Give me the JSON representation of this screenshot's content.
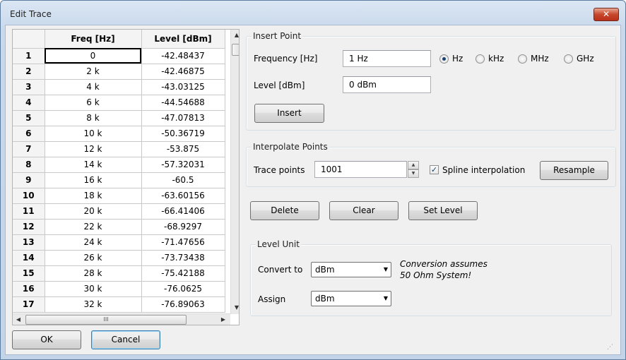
{
  "window": {
    "title": "Edit Trace",
    "close_label": "✕"
  },
  "table": {
    "headers": [
      "",
      "Freq [Hz]",
      "Level [dBm]"
    ],
    "rows": [
      {
        "n": "1",
        "freq": "0",
        "level": "-42.48437"
      },
      {
        "n": "2",
        "freq": "2 k",
        "level": "-42.46875"
      },
      {
        "n": "3",
        "freq": "4 k",
        "level": "-43.03125"
      },
      {
        "n": "4",
        "freq": "6 k",
        "level": "-44.54688"
      },
      {
        "n": "5",
        "freq": "8 k",
        "level": "-47.07813"
      },
      {
        "n": "6",
        "freq": "10 k",
        "level": "-50.36719"
      },
      {
        "n": "7",
        "freq": "12 k",
        "level": "-53.875"
      },
      {
        "n": "8",
        "freq": "14 k",
        "level": "-57.32031"
      },
      {
        "n": "9",
        "freq": "16 k",
        "level": "-60.5"
      },
      {
        "n": "10",
        "freq": "18 k",
        "level": "-63.60156"
      },
      {
        "n": "11",
        "freq": "20 k",
        "level": "-66.41406"
      },
      {
        "n": "12",
        "freq": "22 k",
        "level": "-68.9297"
      },
      {
        "n": "13",
        "freq": "24 k",
        "level": "-71.47656"
      },
      {
        "n": "14",
        "freq": "26 k",
        "level": "-73.73438"
      },
      {
        "n": "15",
        "freq": "28 k",
        "level": "-75.42188"
      },
      {
        "n": "16",
        "freq": "30 k",
        "level": "-76.0625"
      },
      {
        "n": "17",
        "freq": "32 k",
        "level": "-76.89063"
      }
    ],
    "hscroll_grip": "III"
  },
  "insert_point": {
    "title": "Insert Point",
    "frequency_label": "Frequency [Hz]",
    "frequency_value": "1 Hz",
    "units": [
      "Hz",
      "kHz",
      "MHz",
      "GHz"
    ],
    "selected_unit": "Hz",
    "level_label": "Level [dBm]",
    "level_value": "0 dBm",
    "insert_button": "Insert"
  },
  "interpolate": {
    "title": "Interpolate Points",
    "trace_points_label": "Trace points",
    "trace_points_value": "1001",
    "spline_label": "Spline interpolation",
    "spline_checked": true,
    "resample_button": "Resample"
  },
  "actions": {
    "delete": "Delete",
    "clear": "Clear",
    "set_level": "Set Level"
  },
  "level_unit": {
    "title": "Level Unit",
    "convert_label": "Convert to",
    "convert_value": "dBm",
    "assign_label": "Assign",
    "assign_value": "dBm",
    "note_line1": "Conversion assumes",
    "note_line2": "50 Ohm System!"
  },
  "footer": {
    "ok": "OK",
    "cancel": "Cancel"
  }
}
